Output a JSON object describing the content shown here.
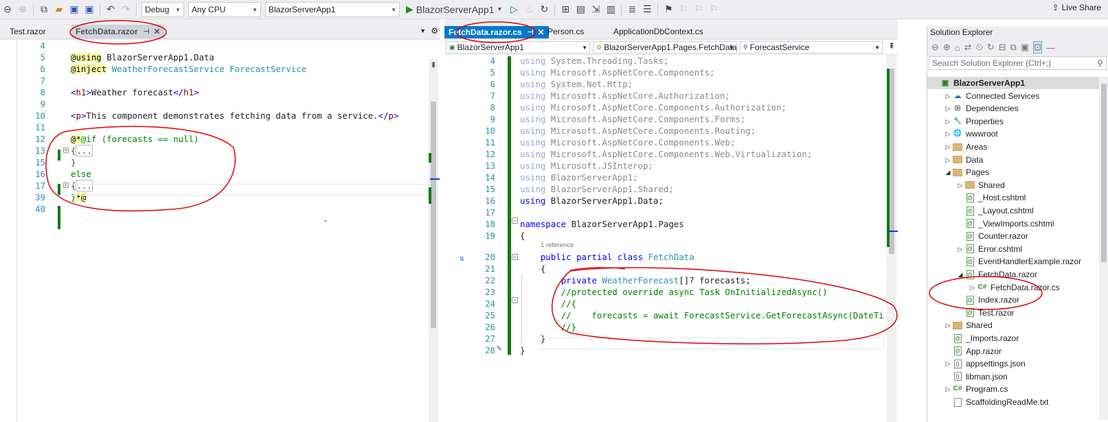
{
  "toolbar": {
    "config": "Debug",
    "platform": "Any CPU",
    "project": "BlazorServerApp1",
    "run_target": "BlazorServerApp1",
    "live_share": "Live Share"
  },
  "left_editor": {
    "tabs": [
      {
        "label": "Test.razor"
      },
      {
        "label": "FetchData.razor"
      }
    ],
    "lines": [
      {
        "n": "4",
        "text": ""
      },
      {
        "n": "5",
        "text": "@using BlazorServerApp1.Data"
      },
      {
        "n": "6",
        "text": "@inject WeatherForecastService ForecastService"
      },
      {
        "n": "7",
        "text": ""
      },
      {
        "n": "8",
        "text": "<h1>Weather forecast</h1>"
      },
      {
        "n": "9",
        "text": ""
      },
      {
        "n": "10",
        "text": "<p>This component demonstrates fetching data from a service.</p>"
      },
      {
        "n": "11",
        "text": ""
      },
      {
        "n": "12",
        "text": "@*@if (forecasts == null)"
      },
      {
        "n": "13",
        "text": "{..."
      },
      {
        "n": "15",
        "text": "}"
      },
      {
        "n": "16",
        "text": "else"
      },
      {
        "n": "17",
        "text": "{..."
      },
      {
        "n": "39",
        "text": "}*@"
      },
      {
        "n": "40",
        "text": ""
      }
    ]
  },
  "right_editor": {
    "tabs": [
      {
        "label": "FetchData.razor.cs"
      },
      {
        "label": "Person.cs"
      },
      {
        "label": "ApplicationDbContext.cs"
      }
    ],
    "nav": {
      "project": "BlazorServerApp1",
      "class": "BlazorServerApp1.Pages.FetchData",
      "member": "ForecastService"
    },
    "reference_hint": "1 reference",
    "lines": [
      {
        "n": "4",
        "text": "using System.Threading.Tasks;"
      },
      {
        "n": "5",
        "text": "using Microsoft.AspNetCore.Components;"
      },
      {
        "n": "6",
        "text": "using System.Net.Http;"
      },
      {
        "n": "7",
        "text": "using Microsoft.AspNetCore.Authorization;"
      },
      {
        "n": "8",
        "text": "using Microsoft.AspNetCore.Components.Authorization;"
      },
      {
        "n": "9",
        "text": "using Microsoft.AspNetCore.Components.Forms;"
      },
      {
        "n": "10",
        "text": "using Microsoft.AspNetCore.Components.Routing;"
      },
      {
        "n": "11",
        "text": "using Microsoft.AspNetCore.Components.Web;"
      },
      {
        "n": "12",
        "text": "using Microsoft.AspNetCore.Components.Web.Virtualization;"
      },
      {
        "n": "13",
        "text": "using Microsoft.JSInterop;"
      },
      {
        "n": "14",
        "text": "using BlazorServerApp1;"
      },
      {
        "n": "15",
        "text": "using BlazorServerApp1.Shared;"
      },
      {
        "n": "16",
        "text": "using BlazorServerApp1.Data;"
      },
      {
        "n": "17",
        "text": ""
      },
      {
        "n": "18",
        "text": "namespace BlazorServerApp1.Pages"
      },
      {
        "n": "19",
        "text": "{"
      },
      {
        "n": "20",
        "text": "    public partial class FetchData"
      },
      {
        "n": "21",
        "text": "    {"
      },
      {
        "n": "22",
        "text": "        private WeatherForecast[]? forecasts;"
      },
      {
        "n": "23",
        "text": "        //protected override async Task OnInitializedAsync()"
      },
      {
        "n": "24",
        "text": "        //{"
      },
      {
        "n": "25",
        "text": "        //    forecasts = await ForecastService.GetForecastAsync(DateTi"
      },
      {
        "n": "26",
        "text": "        //}"
      },
      {
        "n": "27",
        "text": "    }"
      },
      {
        "n": "28",
        "text": "}"
      }
    ]
  },
  "solution_explorer": {
    "title": "Solution Explorer",
    "search_placeholder": "Search Solution Explorer (Ctrl+;)",
    "items": [
      {
        "label": "BlazorServerApp1"
      },
      {
        "label": "Connected Services"
      },
      {
        "label": "Dependencies"
      },
      {
        "label": "Properties"
      },
      {
        "label": "wwwroot"
      },
      {
        "label": "Areas"
      },
      {
        "label": "Data"
      },
      {
        "label": "Pages"
      },
      {
        "label": "Shared"
      },
      {
        "label": "_Host.cshtml"
      },
      {
        "label": "_Layout.cshtml"
      },
      {
        "label": "_ViewImports.cshtml"
      },
      {
        "label": "Counter.razor"
      },
      {
        "label": "Error.cshtml"
      },
      {
        "label": "EventHandlerExample.razor"
      },
      {
        "label": "FetchData.razor"
      },
      {
        "label": "FetchData.razor.cs"
      },
      {
        "label": "Index.razor"
      },
      {
        "label": "Test.razor"
      },
      {
        "label": "Shared"
      },
      {
        "label": "_Imports.razor"
      },
      {
        "label": "App.razor"
      },
      {
        "label": "appsettings.json"
      },
      {
        "label": "libman.json"
      },
      {
        "label": "Program.cs"
      },
      {
        "label": "ScaffoldingReadMe.txt"
      }
    ]
  }
}
